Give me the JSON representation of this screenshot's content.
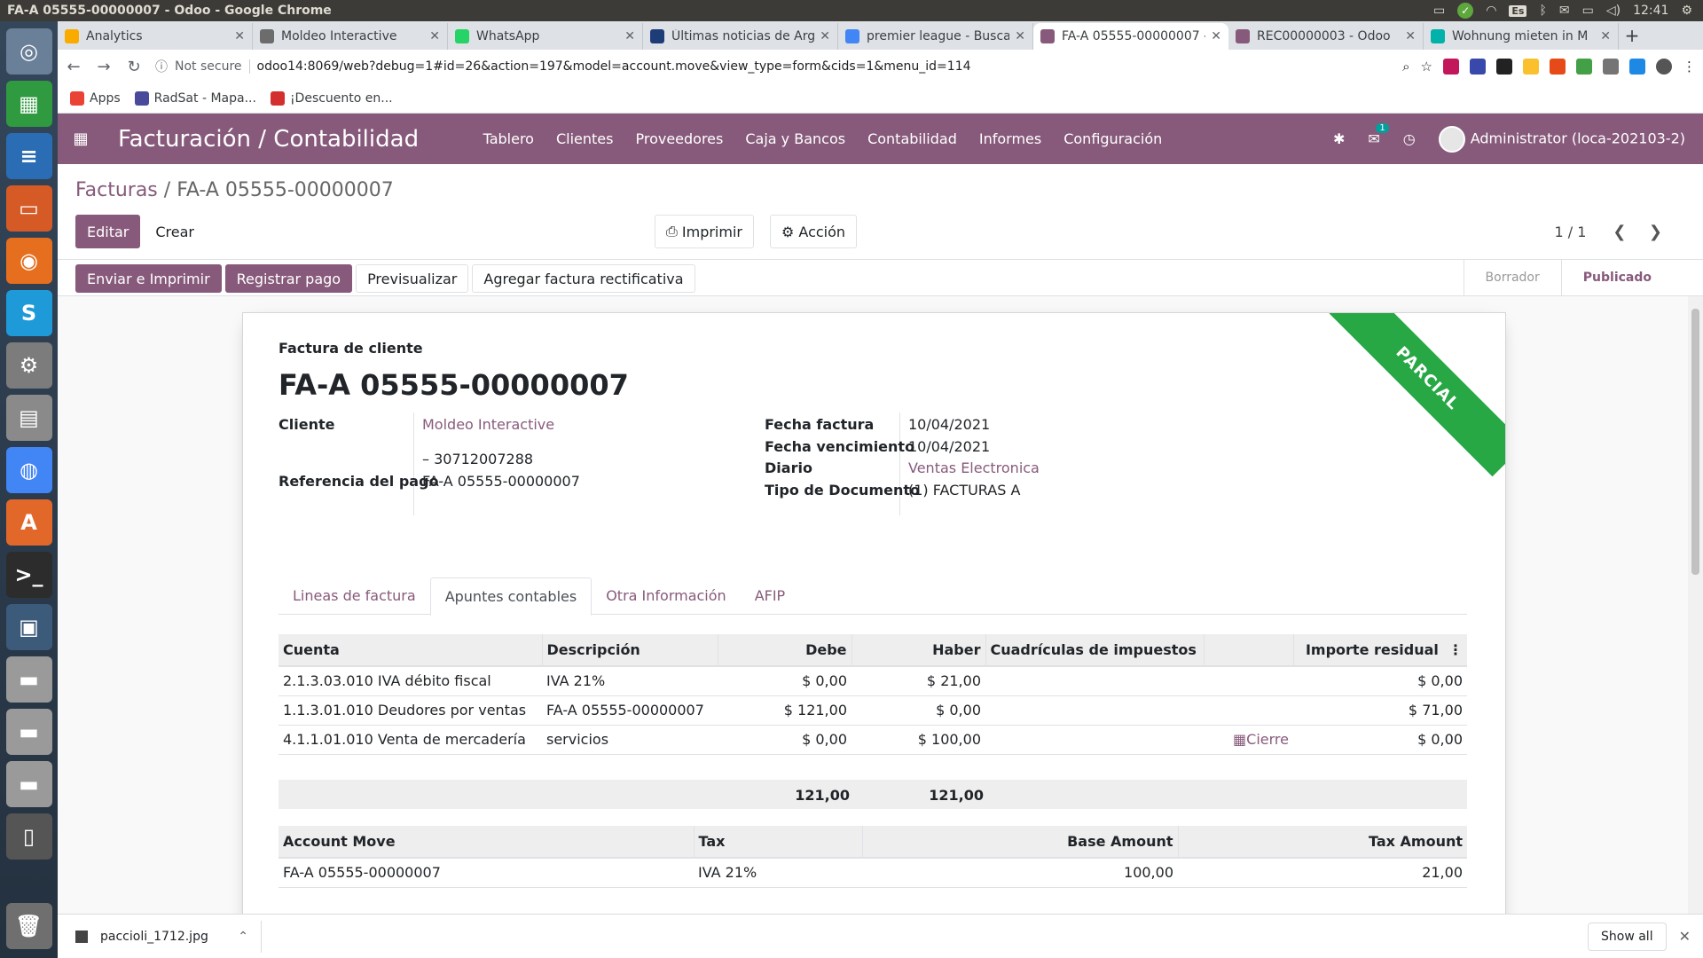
{
  "os": {
    "window_title": "FA-A 05555-00000007 - Odoo - Google Chrome",
    "keyboard": "Es",
    "time": "12:41"
  },
  "launcher": [
    {
      "name": "ubuntu-dash-icon",
      "glyph": "◎",
      "color": "#6a7f98"
    },
    {
      "name": "spreadsheet-icon",
      "glyph": "▦",
      "color": "#2f9a3f"
    },
    {
      "name": "writer-icon",
      "glyph": "≡",
      "color": "#2a6db5"
    },
    {
      "name": "impress-icon",
      "glyph": "▭",
      "color": "#d65a26"
    },
    {
      "name": "firefox-icon",
      "glyph": "◉",
      "color": "#e66f1f"
    },
    {
      "name": "skype-icon",
      "glyph": "S",
      "color": "#1e9ad8"
    },
    {
      "name": "settings-icon",
      "glyph": "⚙",
      "color": "#7c7c7c"
    },
    {
      "name": "files-icon",
      "glyph": "▤",
      "color": "#8a8a8a"
    },
    {
      "name": "chrome-icon",
      "glyph": "◍",
      "color": "#4285f4"
    },
    {
      "name": "software-center-icon",
      "glyph": "A",
      "color": "#e2682a"
    },
    {
      "name": "terminal-icon",
      "glyph": ">_",
      "color": "#2c2c2c"
    },
    {
      "name": "workspace-icon",
      "glyph": "▣",
      "color": "#3c5a7a"
    },
    {
      "name": "drive-icon-1",
      "glyph": "▬",
      "color": "#9a9a9a"
    },
    {
      "name": "drive-icon-2",
      "glyph": "▬",
      "color": "#9a9a9a"
    },
    {
      "name": "drive-icon-3",
      "glyph": "▬",
      "color": "#9a9a9a"
    },
    {
      "name": "device-icon",
      "glyph": "▯",
      "color": "#555"
    }
  ],
  "tabs": [
    {
      "title": "Analytics",
      "color": "#f9ab00"
    },
    {
      "title": "Moldeo Interactive",
      "color": "#6c6c6c"
    },
    {
      "title": "WhatsApp",
      "color": "#25d366"
    },
    {
      "title": "Últimas noticias de Arg",
      "color": "#1d3c78"
    },
    {
      "title": "premier league - Busca",
      "color": "#4285f4"
    },
    {
      "title": "FA-A 05555-00000007 - (",
      "color": "#875a7b",
      "active": true
    },
    {
      "title": "REC00000003 - Odoo",
      "color": "#875a7b"
    },
    {
      "title": "Wohnung mieten in M",
      "color": "#00b2a9"
    }
  ],
  "omnibox": {
    "security": "Not secure",
    "url": "odoo14:8069/web?debug=1#id=26&action=197&model=account.move&view_type=form&cids=1&menu_id=114"
  },
  "bookmarks": [
    {
      "label": "Apps",
      "color": "#ea4335"
    },
    {
      "label": "RadSat - Mapa...",
      "color": "#4a4a9a"
    },
    {
      "label": "¡Descuento en...",
      "color": "#d32f2f"
    }
  ],
  "odoo_nav": {
    "brand": "Facturación / Contabilidad",
    "menu": [
      "Tablero",
      "Clientes",
      "Proveedores",
      "Caja y Bancos",
      "Contabilidad",
      "Informes",
      "Configuración"
    ],
    "chat_count": "1",
    "user": "Administrator (loca-202103-2)"
  },
  "control_panel": {
    "breadcrumb_parent": "Facturas",
    "breadcrumb_current": "FA-A 05555-00000007",
    "edit_label": "Editar",
    "create_label": "Crear",
    "print_label": "Imprimir",
    "action_label": "Acción",
    "pager": "1 / 1"
  },
  "statusbar": {
    "buttons": [
      "Enviar e Imprimir",
      "Registrar pago",
      "Previsualizar",
      "Agregar factura rectificativa"
    ],
    "states": [
      "Borrador",
      "Publicado"
    ],
    "current_state": "Publicado"
  },
  "invoice": {
    "ribbon": "PARCIAL",
    "doc_type": "Factura de cliente",
    "name": "FA-A 05555-00000007",
    "cliente_label": "Cliente",
    "cliente": "Moldeo Interactive",
    "cliente_vat": "– 30712007288",
    "ref_label": "Referencia del pago",
    "ref": "FA-A 05555-00000007",
    "fecha_label": "Fecha factura",
    "fecha": "10/04/2021",
    "venc_label": "Fecha vencimiento",
    "venc": "10/04/2021",
    "diario_label": "Diario",
    "diario": "Ventas Electronica",
    "tipo_label": "Tipo de Documento",
    "tipo": "(1) FACTURAS A"
  },
  "notebook": {
    "tabs": [
      "Lineas de factura",
      "Apuntes contables",
      "Otra Información",
      "AFIP"
    ],
    "active": 1
  },
  "move_lines": {
    "headers": [
      "Cuenta",
      "Descripción",
      "Debe",
      "Haber",
      "Cuadrículas de impuestos",
      "",
      "Importe residual"
    ],
    "rows": [
      {
        "cuenta": "2.1.3.03.010 IVA débito fiscal",
        "desc": "IVA 21%",
        "debe": "$ 0,00",
        "haber": "$ 21,00",
        "tax": "",
        "action": "",
        "residual": "$ 0,00"
      },
      {
        "cuenta": "1.1.3.01.010 Deudores por ventas",
        "desc": "FA-A 05555-00000007",
        "debe": "$ 121,00",
        "haber": "$ 0,00",
        "tax": "",
        "action": "",
        "residual": "$ 71,00"
      },
      {
        "cuenta": "4.1.1.01.010 Venta de mercadería",
        "desc": "servicios",
        "debe": "$ 0,00",
        "haber": "$ 100,00",
        "tax": "",
        "action": "Cierre",
        "residual": "$ 0,00"
      }
    ],
    "total_debe": "121,00",
    "total_haber": "121,00"
  },
  "tax_table": {
    "headers": [
      "Account Move",
      "Tax",
      "Base Amount",
      "Tax Amount"
    ],
    "rows": [
      {
        "move": "FA-A 05555-00000007",
        "tax": "IVA 21%",
        "base": "100,00",
        "amount": "21,00"
      }
    ]
  },
  "download": {
    "file": "paccioli_1712.jpg",
    "show_all": "Show all"
  }
}
